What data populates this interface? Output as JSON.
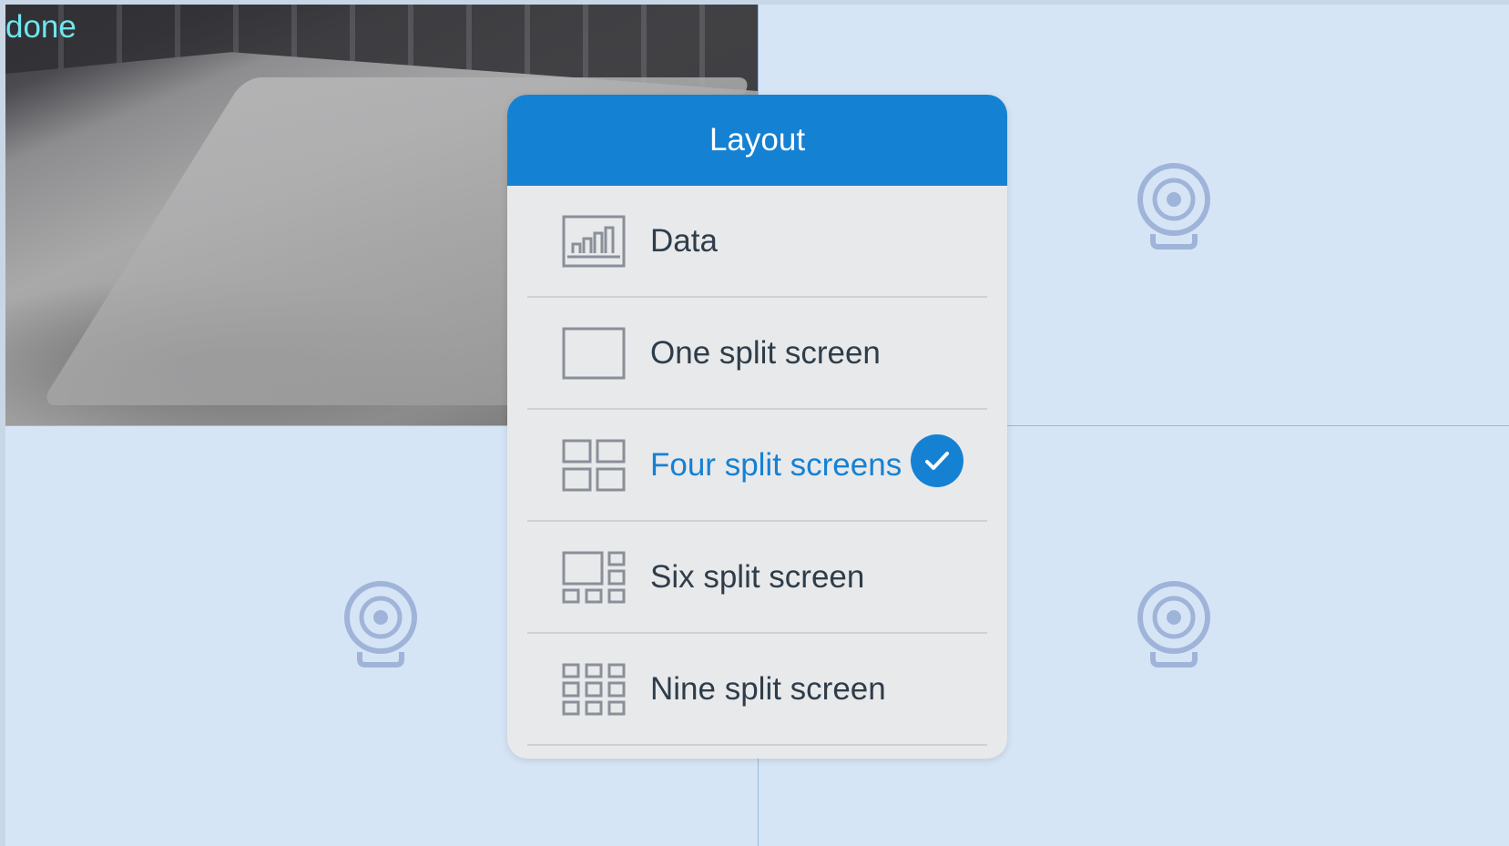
{
  "overlay_status": "done",
  "dialog": {
    "title": "Layout",
    "items": [
      {
        "label": "Data",
        "icon": "data-chart-icon",
        "selected": false
      },
      {
        "label": "One split screen",
        "icon": "one-split-icon",
        "selected": false
      },
      {
        "label": "Four split screens",
        "icon": "four-split-icon",
        "selected": true
      },
      {
        "label": "Six split screen",
        "icon": "six-split-icon",
        "selected": false
      },
      {
        "label": "Nine split screen",
        "icon": "nine-split-icon",
        "selected": false
      }
    ]
  },
  "colors": {
    "accent": "#1581d3",
    "tile_background": "#d6e5f6",
    "camera_placeholder": "#9fb4d8",
    "status_text": "#6fe6f0"
  },
  "camera_tiles": [
    {
      "state": "live-feed"
    },
    {
      "state": "empty",
      "icon": "camera-placeholder-icon"
    },
    {
      "state": "empty",
      "icon": "camera-placeholder-icon"
    },
    {
      "state": "empty",
      "icon": "camera-placeholder-icon"
    }
  ]
}
